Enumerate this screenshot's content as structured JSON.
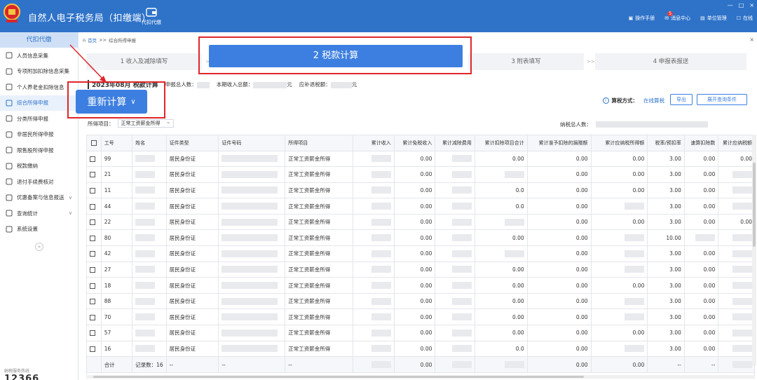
{
  "header": {
    "title": "自然人电子税务局（扣缴端）",
    "tool_label": "代扣代缴",
    "right_items": [
      {
        "label": "操作手册",
        "icon": "manual-icon"
      },
      {
        "label": "消息中心",
        "icon": "message-icon",
        "badge": "5"
      },
      {
        "label": "单位管理",
        "icon": "unit-icon"
      },
      {
        "label": "在线",
        "icon": "online-icon"
      }
    ],
    "window_controls": [
      "—",
      "□",
      "×"
    ]
  },
  "sidebar": {
    "heading": "代扣代缴",
    "items": [
      {
        "label": "人员信息采集",
        "icon": "person-icon"
      },
      {
        "label": "专项附加扣除信息采集",
        "icon": "list-icon"
      },
      {
        "label": "个人养老金扣除信息",
        "icon": "doc-icon"
      },
      {
        "label": "综合所得申报",
        "icon": "form-icon",
        "active": true
      },
      {
        "label": "分类所得申报",
        "icon": "category-icon"
      },
      {
        "label": "非居民所得申报",
        "icon": "nonresident-icon"
      },
      {
        "label": "限售股所得申报",
        "icon": "chart-icon"
      },
      {
        "label": "税款缴纳",
        "icon": "tax-icon"
      },
      {
        "label": "退付手续费核对",
        "icon": "refund-icon"
      },
      {
        "label": "优惠备案与信息报送",
        "icon": "report-icon",
        "arrow": "∨"
      },
      {
        "label": "查询统计",
        "icon": "query-icon",
        "arrow": "∨"
      },
      {
        "label": "系统设置",
        "icon": "settings-icon"
      }
    ],
    "collapse": "«",
    "hotline_label": "纳税服务热线",
    "hotline_number": "12366"
  },
  "breadcrumb": {
    "home": "首页",
    "sep": ">>",
    "current": "综合所得申报"
  },
  "steps": [
    {
      "label": "1 收入及减除填写"
    },
    {
      "label": "2 税款计算",
      "active": true
    },
    {
      "label": "3 附表填写"
    },
    {
      "label": "4 申报表报送"
    }
  ],
  "step_sep": ">>",
  "info": {
    "period": "2023年08月 税款计算",
    "declare_count_label": "申报总人数：",
    "income_label": "本期收入总额：",
    "income_unit": "元",
    "tax_label": "应补退税额：",
    "tax_unit": "元"
  },
  "recalc_button": "重新计算",
  "calc_mode": {
    "label": "算税方式：",
    "value": "在线算税"
  },
  "buttons": {
    "export": "导出",
    "expand": "展开查询条件"
  },
  "filter": {
    "label": "所得项目：",
    "value": "正常工资薪金所得"
  },
  "total_people_label": "纳税总人数：",
  "table": {
    "headers": [
      "工号",
      "姓名",
      "证件类型",
      "证件号码",
      "所得项目",
      "累计收入",
      "累计免税收入",
      "累计减除费用",
      "累计扣除项目合计",
      "累计准予扣除的捐赠额",
      "累计应纳税所得额",
      "税率/预扣率",
      "速算扣除数",
      "累计应纳税额"
    ],
    "rows": [
      {
        "id": "99",
        "type": "居民身份证",
        "item": "正常工资薪金所得",
        "exempt": "0.00",
        "deduct_total": "0.00",
        "donation": "0.00",
        "taxable": "0.00",
        "rate": "3.00",
        "quick": "0.00",
        "tax": "0.00"
      },
      {
        "id": "21",
        "type": "居民身份证",
        "item": "正常工资薪金所得",
        "exempt": "0.00",
        "deduct_total": "",
        "donation": "0.00",
        "taxable": "0.00",
        "rate": "3.00",
        "quick": "0.00",
        "tax": ""
      },
      {
        "id": "11",
        "type": "居民身份证",
        "item": "正常工资薪金所得",
        "exempt": "0.00",
        "deduct_total": "0.0",
        "donation": "0.00",
        "taxable": "0.00",
        "rate": "3.00",
        "quick": "0.00",
        "tax": ""
      },
      {
        "id": "44",
        "type": "居民身份证",
        "item": "正常工资薪金所得",
        "exempt": "0.00",
        "deduct_total": "0.0",
        "donation": "0.00",
        "taxable": "",
        "rate": "3.00",
        "quick": "0.00",
        "tax": ""
      },
      {
        "id": "22",
        "type": "居民身份证",
        "item": "正常工资薪金所得",
        "exempt": "0.00",
        "deduct_total": "",
        "donation": "0.00",
        "taxable": "0.00",
        "rate": "3.00",
        "quick": "0.00",
        "tax": "0.00"
      },
      {
        "id": "80",
        "type": "居民身份证",
        "item": "正常工资薪金所得",
        "exempt": "0.00",
        "deduct_total": "0.00",
        "donation": "0.00",
        "taxable": "",
        "rate": "10.00",
        "quick": "",
        "tax": ""
      },
      {
        "id": "42",
        "type": "居民身份证",
        "item": "正常工资薪金所得",
        "exempt": "0.00",
        "deduct_total": "",
        "donation": "0.00",
        "taxable": "",
        "rate": "3.00",
        "quick": "0.00",
        "tax": ""
      },
      {
        "id": "27",
        "type": "居民身份证",
        "item": "正常工资薪金所得",
        "exempt": "0.00",
        "deduct_total": "0.00",
        "donation": "0.00",
        "taxable": "",
        "rate": "3.00",
        "quick": "0.00",
        "tax": ""
      },
      {
        "id": "18",
        "type": "居民身份证",
        "item": "正常工资薪金所得",
        "exempt": "0.00",
        "deduct_total": "0.00",
        "donation": "0.00",
        "taxable": "0.00",
        "rate": "3.00",
        "quick": "0.00",
        "tax": ""
      },
      {
        "id": "88",
        "type": "居民身份证",
        "item": "正常工资薪金所得",
        "exempt": "0.00",
        "deduct_total": "0.00",
        "donation": "0.00",
        "taxable": "",
        "rate": "3.00",
        "quick": "0.00",
        "tax": ""
      },
      {
        "id": "70",
        "type": "居民身份证",
        "item": "正常工资薪金所得",
        "exempt": "0.00",
        "deduct_total": "0.00",
        "donation": "0.00",
        "taxable": "",
        "rate": "3.00",
        "quick": "0.00",
        "tax": ""
      },
      {
        "id": "57",
        "type": "居民身份证",
        "item": "正常工资薪金所得",
        "exempt": "0.00",
        "deduct_total": "0.00",
        "donation": "0.00",
        "taxable": "0.00",
        "rate": "3.00",
        "quick": "0.00",
        "tax": ""
      },
      {
        "id": "16",
        "type": "居民身份证",
        "item": "正常工资薪金所得",
        "exempt": "0.00",
        "deduct_total": "0.0",
        "donation": "0.00",
        "taxable": "",
        "rate": "3.00",
        "quick": "0.00",
        "tax": ""
      }
    ],
    "footer": {
      "label": "合计",
      "count": "记录数：16",
      "dash": "--",
      "exempt": "0.00",
      "donation": "0.00",
      "taxable": "0.00"
    }
  },
  "colors": {
    "brand": "#2f73c9",
    "primary_button": "#3d7fe0",
    "highlight_border": "#e0262a"
  }
}
